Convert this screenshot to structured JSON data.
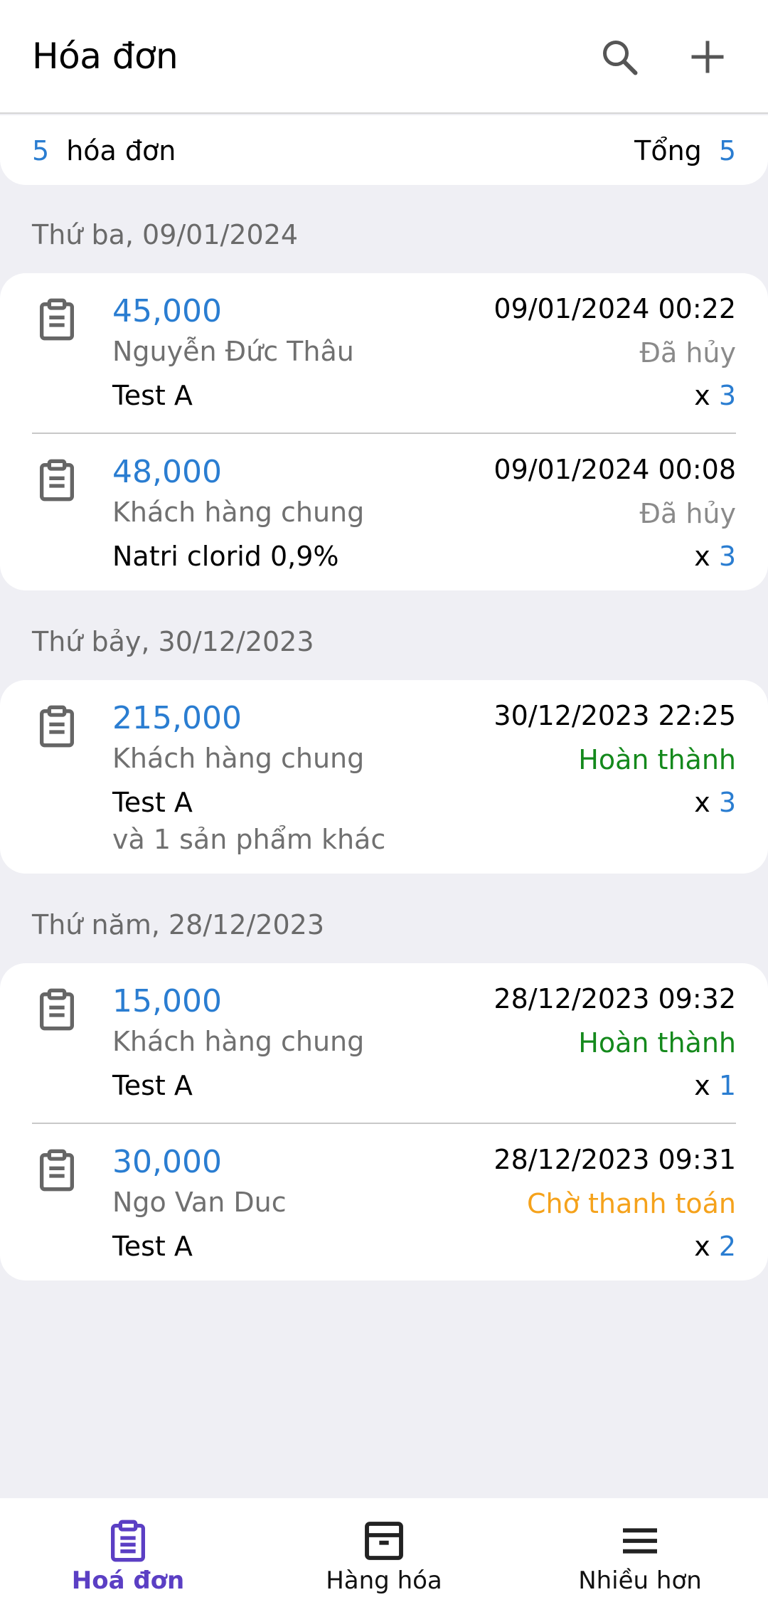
{
  "app_bar": {
    "title": "Hóa đơn",
    "search_icon": "search-icon",
    "add_icon": "plus-icon"
  },
  "summary": {
    "count": "5",
    "count_label": "hóa đơn",
    "total_label": "Tổng",
    "total_value": "5"
  },
  "colors": {
    "accent": "#2a7dd1",
    "status_cancelled": "#8a8a8a",
    "status_completed": "#14891c",
    "status_pending": "#f5a21b",
    "nav_active": "#5b3fc4"
  },
  "groups": [
    {
      "date_header": "Thứ ba, 09/01/2024",
      "invoices": [
        {
          "amount": "45,000",
          "customer": "Nguyễn Đức Thâu",
          "product": "Test A",
          "datetime": "09/01/2024 00:22",
          "status": "Đã hủy",
          "qty_prefix": "x",
          "qty": "3"
        },
        {
          "amount": "48,000",
          "customer": "Khách hàng chung",
          "product": "Natri clorid 0,9%",
          "datetime": "09/01/2024 00:08",
          "status": "Đã hủy",
          "qty_prefix": "x",
          "qty": "3"
        }
      ]
    },
    {
      "date_header": "Thứ bảy, 30/12/2023",
      "invoices": [
        {
          "amount": "215,000",
          "customer": "Khách hàng chung",
          "product": "Test A",
          "more": "và 1 sản phẩm khác",
          "datetime": "30/12/2023 22:25",
          "status": "Hoàn thành",
          "qty_prefix": "x",
          "qty": "3"
        }
      ]
    },
    {
      "date_header": "Thứ năm, 28/12/2023",
      "invoices": [
        {
          "amount": "15,000",
          "customer": "Khách hàng chung",
          "product": "Test A",
          "datetime": "28/12/2023 09:32",
          "status": "Hoàn thành",
          "qty_prefix": "x",
          "qty": "1"
        },
        {
          "amount": "30,000",
          "customer": "Ngo Van Duc",
          "product": "Test A",
          "datetime": "28/12/2023 09:31",
          "status": "Chờ thanh toán",
          "qty_prefix": "x",
          "qty": "2"
        }
      ]
    }
  ],
  "bottom_nav": {
    "items": [
      {
        "label": "Hoá đơn",
        "icon": "clipboard-icon",
        "active": true
      },
      {
        "label": "Hàng hóa",
        "icon": "archive-box-icon",
        "active": false
      },
      {
        "label": "Nhiều hơn",
        "icon": "menu-icon",
        "active": false
      }
    ]
  }
}
